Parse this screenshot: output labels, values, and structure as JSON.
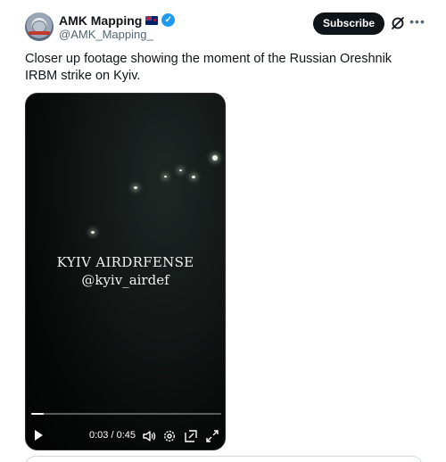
{
  "author": {
    "display_name": "AMK Mapping",
    "flag_icon": "new-zealand-flag-icon",
    "verified_icon": "verified-badge-icon",
    "handle": "@AMK_Mapping_"
  },
  "header_actions": {
    "subscribe_label": "Subscribe",
    "grok_icon": "grok-icon",
    "more_icon": "more-options-icon"
  },
  "post": {
    "text": "Closer up footage showing the moment of the Russian Oreshnik IRBM strike on Kyiv."
  },
  "video": {
    "overlay_line1": "KYIV AIRDRFENSE",
    "overlay_line2": "@kyiv_airdef",
    "time_display": "0:03 / 0:45",
    "progress_fraction": 0.067,
    "controls": [
      "play-icon",
      "volume-icon",
      "settings-icon",
      "pip-icon",
      "fullscreen-icon"
    ]
  },
  "colors": {
    "accent": "#1d9bf0",
    "subscribe_bg": "#0f1419",
    "handle_text": "#536471"
  }
}
